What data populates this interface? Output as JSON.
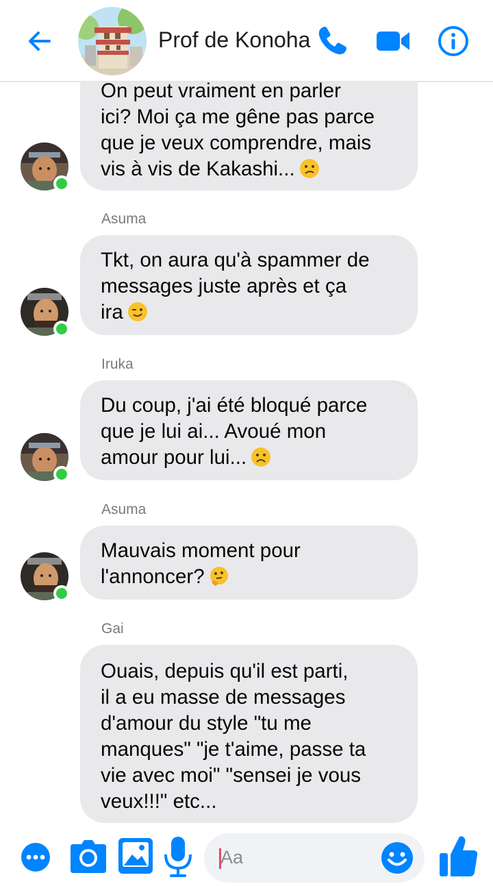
{
  "header": {
    "title": "Prof de Konoha",
    "back_icon": "arrow-left-icon",
    "call_icon": "phone-icon",
    "video_icon": "video-camera-icon",
    "info_icon": "info-icon"
  },
  "messages": [
    {
      "sender": "",
      "lines": [
        "On peut vraiment en parler",
        "ici? Moi ça me gêne pas parce",
        "que je veux comprendre, mais",
        "vis à vis de Kakashi..."
      ],
      "emoji": "confused-face-emoji",
      "avatar": "iruka-avatar",
      "online": true
    },
    {
      "sender": "Asuma",
      "lines": [
        "Tkt, on aura qu'à spammer de",
        "messages juste après et ça",
        "ira"
      ],
      "emoji": "winking-face-emoji",
      "avatar": "asuma-avatar",
      "online": true
    },
    {
      "sender": "Iruka",
      "lines": [
        "Du coup, j'ai été bloqué parce",
        "que je lui ai... Avoué mon",
        "amour pour lui..."
      ],
      "emoji": "sad-face-emoji",
      "avatar": "iruka-avatar",
      "online": true
    },
    {
      "sender": "Asuma",
      "lines": [
        "Mauvais moment pour",
        "l'annoncer?"
      ],
      "emoji": "thinking-face-emoji",
      "avatar": "asuma-avatar",
      "online": true
    },
    {
      "sender": "Gai",
      "lines": [
        "Ouais, depuis qu'il est parti,",
        "il a eu masse de messages",
        "d'amour du style \"tu me",
        "manques\" \"je t'aime, passe ta",
        "vie avec moi\" \"sensei je vous",
        "veux!!!\" etc..."
      ],
      "emoji": "",
      "avatar": "",
      "online": false
    }
  ],
  "composer": {
    "placeholder": "Aa",
    "more_icon": "more-options-icon",
    "camera_icon": "camera-icon",
    "gallery_icon": "image-gallery-icon",
    "mic_icon": "microphone-icon",
    "emoji_icon": "emoji-icon",
    "like_icon": "thumbs-up-icon"
  },
  "colors": {
    "accent": "#0084ff",
    "bubble": "#e9e9eb",
    "online": "#31cc46",
    "sender": "#7a7a7a"
  }
}
